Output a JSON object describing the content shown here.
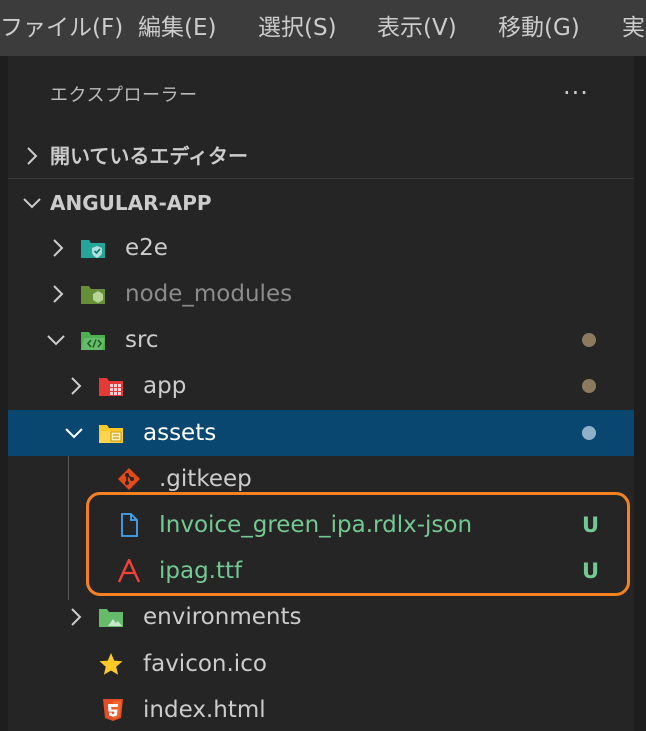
{
  "menubar": {
    "items": [
      "ファイル(F)",
      "編集(E)",
      "選択(S)",
      "表示(V)",
      "移動(G)",
      "実"
    ]
  },
  "explorer": {
    "title": "エクスプローラー",
    "more_label": "···"
  },
  "sections": {
    "open_editors": "開いているエディター",
    "project": "ANGULAR-APP"
  },
  "tree": [
    {
      "name": "e2e",
      "type": "folder",
      "icon": "folder-test-icon",
      "expanded": false
    },
    {
      "name": "node_modules",
      "type": "folder",
      "icon": "folder-node-icon",
      "expanded": false
    },
    {
      "name": "src",
      "type": "folder",
      "icon": "folder-src-icon",
      "expanded": true
    },
    {
      "name": "app",
      "type": "folder",
      "icon": "folder-app-icon",
      "expanded": false
    },
    {
      "name": "assets",
      "type": "folder",
      "icon": "folder-assets-icon",
      "expanded": true
    },
    {
      "name": ".gitkeep",
      "type": "file",
      "icon": "git-icon"
    },
    {
      "name": "Invoice_green_ipa.rdlx-json",
      "type": "file",
      "icon": "file-icon",
      "status": "U"
    },
    {
      "name": "ipag.ttf",
      "type": "file",
      "icon": "font-icon",
      "status": "U"
    },
    {
      "name": "environments",
      "type": "folder",
      "icon": "folder-environment-icon",
      "expanded": false
    },
    {
      "name": "favicon.ico",
      "type": "file",
      "icon": "star-icon"
    },
    {
      "name": "index.html",
      "type": "file",
      "icon": "html5-icon"
    }
  ],
  "colors": {
    "selection": "#094771",
    "untracked": "#73c991",
    "modified_dot": "#8b7a5e",
    "highlight": "#f58220"
  }
}
